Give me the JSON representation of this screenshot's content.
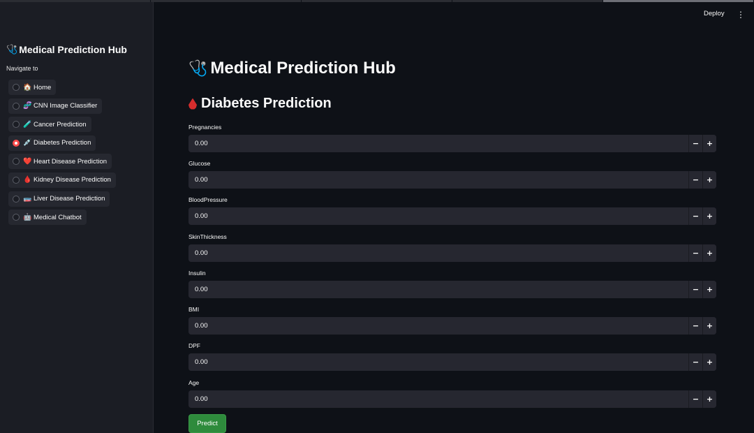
{
  "sidebar": {
    "title": "Medical Prediction Hub",
    "title_icon": "stethoscope-icon",
    "nav_label": "Navigate to",
    "items": [
      {
        "emoji": "🏠",
        "label": "Home",
        "checked": false
      },
      {
        "emoji": "🧬",
        "label": "CNN Image Classifier",
        "checked": false
      },
      {
        "emoji": "🧪",
        "label": "Cancer Prediction",
        "checked": false
      },
      {
        "emoji": "💉",
        "label": "Diabetes Prediction",
        "checked": true
      },
      {
        "emoji": "❤️",
        "label": "Heart Disease Prediction",
        "checked": false
      },
      {
        "emoji": "🩸",
        "label": "Kidney Disease Prediction",
        "checked": false
      },
      {
        "emoji": "🧫",
        "label": "Liver Disease Prediction",
        "checked": false
      },
      {
        "emoji": "🤖",
        "label": "Medical Chatbot",
        "checked": false
      }
    ]
  },
  "header": {
    "deploy_label": "Deploy",
    "menu_icon": "⋮"
  },
  "main": {
    "title": "Medical Prediction Hub",
    "title_icon": "stethoscope-icon",
    "subtitle": "Diabetes Prediction",
    "subtitle_icon": "blood-drop-icon",
    "fields": [
      {
        "label": "Pregnancies",
        "value": "0.00"
      },
      {
        "label": "Glucose",
        "value": "0.00"
      },
      {
        "label": "BloodPressure",
        "value": "0.00"
      },
      {
        "label": "SkinThickness",
        "value": "0.00"
      },
      {
        "label": "Insulin",
        "value": "0.00"
      },
      {
        "label": "BMI",
        "value": "0.00"
      },
      {
        "label": "DPF",
        "value": "0.00"
      },
      {
        "label": "Age",
        "value": "0.00"
      }
    ],
    "minus_label": "−",
    "plus_label": "+",
    "predict_label": "Predict"
  },
  "colors": {
    "background": "#0e1117",
    "sidebar": "#1b1d24",
    "input": "#262730",
    "accent_radio": "#ff4b4b",
    "predict_button": "#2e8b3c"
  }
}
